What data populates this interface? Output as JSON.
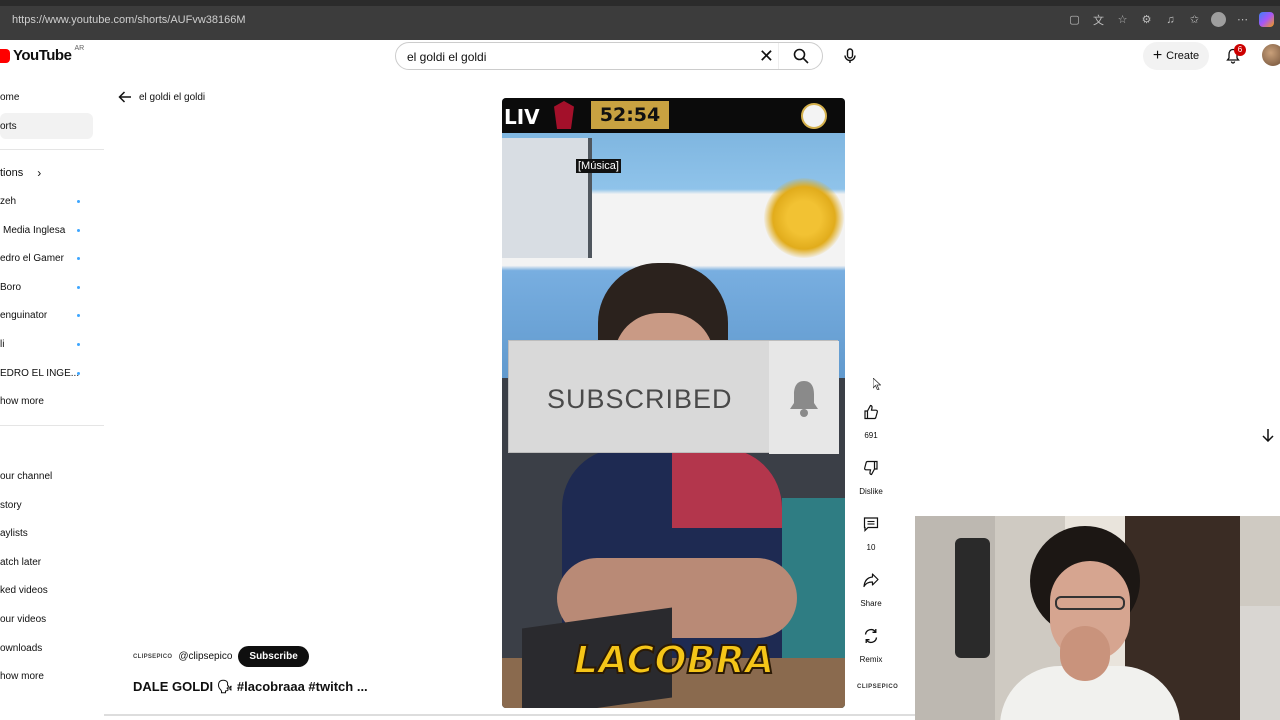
{
  "browser": {
    "url": "https://www.youtube.com/shorts/AUFvw38166M"
  },
  "header": {
    "logo_text": "YouTube",
    "country_code": "AR",
    "search_value": "el goldi el goldi",
    "create_label": "Create",
    "notification_count": "6"
  },
  "sidebar": {
    "items": [
      {
        "label": "ome",
        "active": false
      },
      {
        "label": "orts",
        "active": true
      }
    ],
    "subscriptions_header": "tions",
    "subscriptions": [
      {
        "label": "zeh"
      },
      {
        "label": "Media Inglesa"
      },
      {
        "label": "edro el Gamer"
      },
      {
        "label": "Boro"
      },
      {
        "label": "enguinator"
      },
      {
        "label": "li"
      },
      {
        "label": "EDRO EL INGE..."
      }
    ],
    "show_more_1": "how more",
    "you_items": [
      {
        "label": "our channel"
      },
      {
        "label": "story"
      },
      {
        "label": "aylists"
      },
      {
        "label": "atch later"
      },
      {
        "label": "ked videos"
      },
      {
        "label": "our videos"
      },
      {
        "label": "ownloads"
      }
    ],
    "show_more_2": "how more"
  },
  "back_link": "el goldi el goldi",
  "video": {
    "scoreboard_team": "LIV",
    "clock": "52:54",
    "caption": "[Música]",
    "overlay_text": "SUBSCRIBED",
    "logo_text": "LACOBRA"
  },
  "actions": {
    "like_count": "691",
    "dislike_label": "Dislike",
    "comment_count": "10",
    "share_label": "Share",
    "remix_label": "Remix",
    "channel_mini": "CLIPSEPICO"
  },
  "channel": {
    "logo_text": "CLIPSEPICO",
    "handle": "@clipsepico",
    "subscribe_label": "Subscribe"
  },
  "title": "DALE GOLDI 🗣 #lacobraaa #twitch ...",
  "colors": {
    "brand_red": "#ff0000",
    "badge_red": "#cc0000",
    "subscribe_bg": "#0f0f0f",
    "sub_dot_blue": "#3ea6ff"
  }
}
